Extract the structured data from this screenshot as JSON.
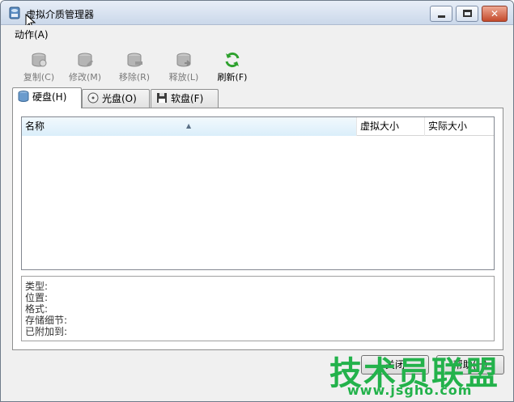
{
  "window": {
    "title": "虚拟介质管理器"
  },
  "menu": {
    "action": "动作(A)"
  },
  "toolbar": {
    "copy": "复制(C)",
    "modify": "修改(M)",
    "remove": "移除(R)",
    "release": "释放(L)",
    "refresh": "刷新(F)"
  },
  "tabs": {
    "hard_disk": "硬盘(H)",
    "optical": "光盘(O)",
    "floppy": "软盘(F)"
  },
  "list": {
    "col_name": "名称",
    "col_virtual_size": "虚拟大小",
    "col_actual_size": "实际大小"
  },
  "details": {
    "type": "类型:",
    "location": "位置:",
    "format": "格式:",
    "storage": "存储细节:",
    "attached": "已附加到:"
  },
  "buttons": {
    "close": "关闭",
    "help": "帮助(H)"
  },
  "watermark": {
    "main": "技术员联盟",
    "url": "www.jsgho.com"
  },
  "colors": {
    "accent": "#23b24b",
    "title_bg": "#cbd8ea"
  }
}
